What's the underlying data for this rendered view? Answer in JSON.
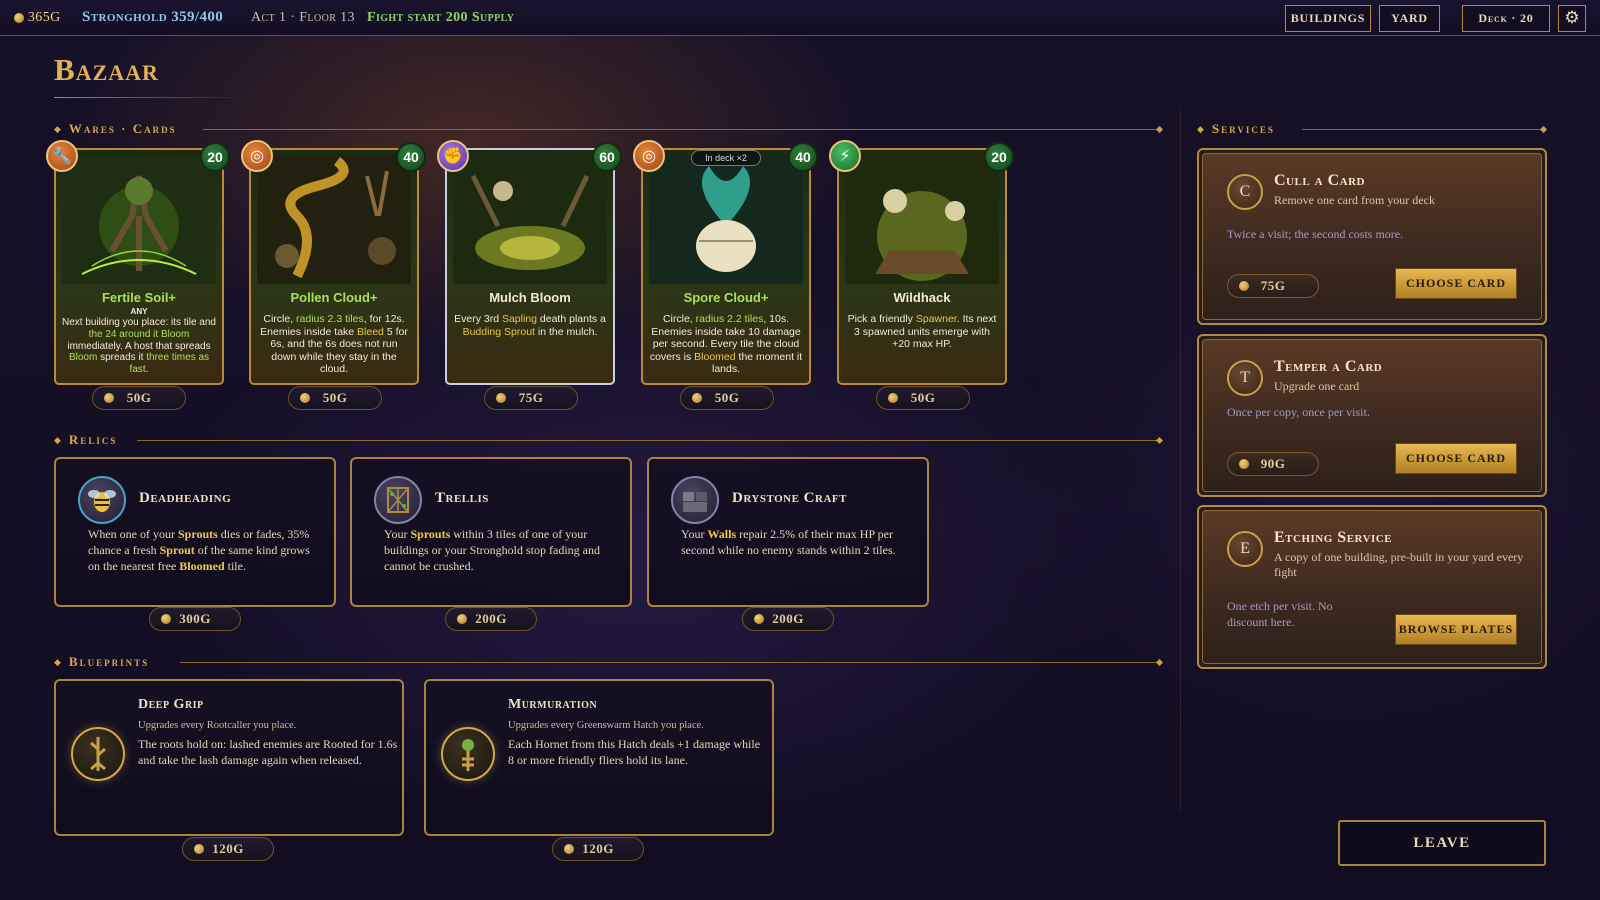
{
  "topbar": {
    "gold": "365G",
    "stronghold": "Stronghold 359/400",
    "location": "Act 1 · Floor 13",
    "fight_start": "Fight start 200 Supply",
    "buttons": {
      "buildings": "BUILDINGS",
      "yard": "YARD",
      "deck": "Deck · 20"
    },
    "settings_icon": "gear-icon"
  },
  "page": {
    "title": "Bazaar"
  },
  "sections": {
    "wares": "Wares · Cards",
    "relics": "Relics",
    "blueprints": "Blueprints",
    "services": "Services"
  },
  "cards": [
    {
      "name": "Fertile Soil+",
      "cost": "20",
      "type_icon": "wrench-icon",
      "subtitle": "ANY",
      "desc_parts": [
        "Next building you place: its tile and ",
        "the 24 around it ",
        "Bloom",
        " immediately. A host that spreads ",
        "Bloom",
        " spreads it ",
        "three times as fast",
        "."
      ],
      "price": "50G"
    },
    {
      "name": "Pollen Cloud+",
      "cost": "40",
      "type_icon": "target-icon",
      "desc_parts": [
        "Circle, ",
        "radius 2.3 tiles",
        ", for 12s. Enemies inside take ",
        "Bleed",
        " 5 for 6s, and the 6s does not run down while they stay in the cloud."
      ],
      "price": "50G"
    },
    {
      "name": "Mulch Bloom",
      "cost": "60",
      "type_icon": "fist-icon",
      "desc_parts": [
        "Every 3rd ",
        "Sapling",
        " death plants a ",
        "Budding Sprout",
        " in the mulch."
      ],
      "price": "75G"
    },
    {
      "name": "Spore Cloud+",
      "cost": "40",
      "type_icon": "target-icon",
      "in_deck": "In deck ×2",
      "desc_parts": [
        "Circle, ",
        "radius 2.2 tiles",
        ", 10s. Enemies inside take 10 damage per second. Every tile the cloud covers is ",
        "Bloomed",
        " the moment it lands."
      ],
      "price": "50G"
    },
    {
      "name": "Wildhack",
      "cost": "20",
      "type_icon": "lightning-icon",
      "desc_parts": [
        "Pick a friendly ",
        "Spawner",
        ". Its next 3 spawned units emerge with +20 max HP."
      ],
      "price": "50G"
    }
  ],
  "relics": [
    {
      "name": "Deadheading",
      "icon": "bee-icon",
      "desc_parts": [
        "When one of your ",
        "Sprouts",
        " dies or fades, 35% chance a fresh ",
        "Sprout",
        " of the same kind grows on the nearest free ",
        "Bloomed",
        " tile."
      ],
      "price": "300G"
    },
    {
      "name": "Trellis",
      "icon": "trellis-icon",
      "desc_parts": [
        "Your ",
        "Sprouts",
        " within 3 tiles of one of your buildings or your Stronghold stop fading and cannot be crushed."
      ],
      "price": "200G"
    },
    {
      "name": "Drystone Craft",
      "icon": "stone-wall-icon",
      "desc_parts": [
        "Your ",
        "Walls",
        " repair 2.5% of their max HP per second while no enemy stands within 2 tiles."
      ],
      "price": "200G"
    }
  ],
  "blueprints": [
    {
      "name": "Deep Grip",
      "icon": "root-totem-icon",
      "upgrades": "Upgrades every Rootcaller you place.",
      "desc": "The roots hold on: lashed enemies are Rooted for 1.6s and take the lash damage again when released.",
      "price": "120G"
    },
    {
      "name": "Murmuration",
      "icon": "hornet-totem-icon",
      "upgrades": "Upgrades every Greenswarm Hatch you place.",
      "desc": "Each Hornet from this Hatch deals +1 damage while 8 or more friendly fliers hold its lane.",
      "price": "120G"
    }
  ],
  "services": [
    {
      "letter": "C",
      "name": "Cull a Card",
      "sub": "Remove one card from your deck",
      "note": "Twice a visit; the second costs more.",
      "price": "75G",
      "button": "CHOOSE CARD"
    },
    {
      "letter": "T",
      "name": "Temper a Card",
      "sub": "Upgrade one card",
      "note": "Once per copy, once per visit.",
      "price": "90G",
      "button": "CHOOSE CARD"
    },
    {
      "letter": "E",
      "name": "Etching Service",
      "sub": "A copy of one building, pre-built in your yard every fight",
      "note": "One etch per visit. No discount here.",
      "button": "BROWSE PLATES"
    }
  ],
  "leave_label": "LEAVE",
  "colors": {
    "accent_gold": "#d4a84a",
    "keyword_green": "#a8e05a",
    "keyword_yellow": "#e8c64c",
    "cost_green": "#2f7d3a"
  }
}
